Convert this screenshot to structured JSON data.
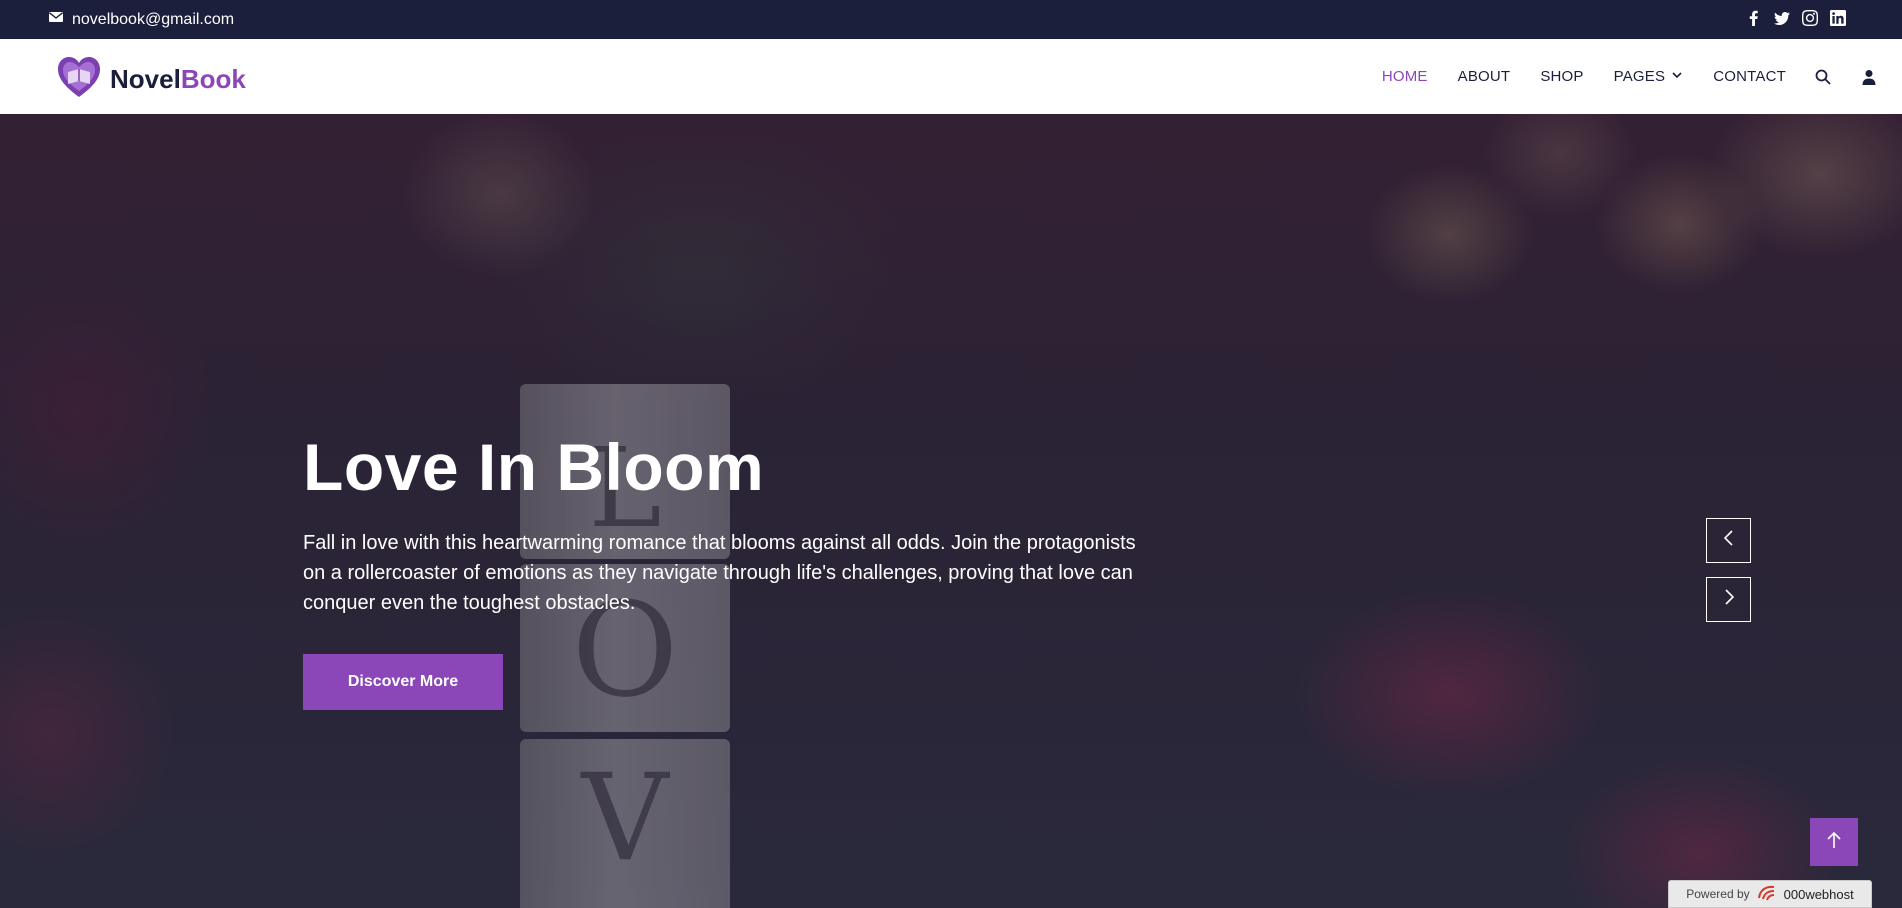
{
  "topbar": {
    "email": "novelbook@gmail.com",
    "socials": [
      "facebook-icon",
      "twitter-icon",
      "instagram-icon",
      "linkedin-icon"
    ]
  },
  "brand": {
    "name_part1": "Novel",
    "name_part2": "Book",
    "accent_color": "#8b47b8",
    "dark_color": "#1b1f3b"
  },
  "nav": {
    "items": [
      {
        "label": "HOME",
        "active": true
      },
      {
        "label": "ABOUT"
      },
      {
        "label": "SHOP"
      },
      {
        "label": "PAGES",
        "dropdown": true
      },
      {
        "label": "CONTACT"
      }
    ],
    "icons": [
      "search-icon",
      "user-icon"
    ]
  },
  "hero": {
    "title": "Love In Bloom",
    "description": "Fall in love with this heartwarming romance that blooms against all odds. Join the protagonists on a rollercoaster of emotions as they navigate through life's challenges, proving that love can conquer even the toughest obstacles.",
    "button_label": "Discover More",
    "block_letters": [
      "L",
      "O",
      "V"
    ]
  },
  "footer_badge": {
    "prefix": "Powered by",
    "brand": "000webhost"
  }
}
